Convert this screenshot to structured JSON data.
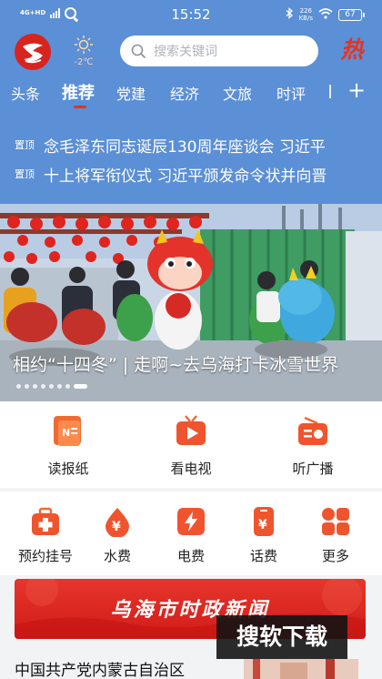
{
  "status_bar": {
    "network": "4G+HD",
    "time": "15:52",
    "net_speed_value": "226",
    "net_speed_unit": "KB/s",
    "battery": "67"
  },
  "header": {
    "weather_temp": "-2℃",
    "search_placeholder": "搜索关键词",
    "hot_label": "热",
    "accent_color": "#5b8fd6"
  },
  "tabs": [
    {
      "label": "头条"
    },
    {
      "label": "推荐"
    },
    {
      "label": "党建"
    },
    {
      "label": "经济"
    },
    {
      "label": "文旅"
    },
    {
      "label": "时评"
    }
  ],
  "active_tab": "推荐",
  "tab_add": "+",
  "pinned": [
    {
      "tag": "置顶",
      "text": "念毛泽东同志诞辰130周年座谈会 习近平"
    },
    {
      "tag": "置顶",
      "text": "十上将军衔仪式 习近平颁发命令状并向晋"
    }
  ],
  "banner": {
    "caption": "相约“十四冬” | 走啊~去乌海打卡冰雪世界",
    "slide_count": 8,
    "active_slide": 8
  },
  "services_row1": [
    {
      "label": "读报纸",
      "icon": "newspaper-icon"
    },
    {
      "label": "看电视",
      "icon": "tv-icon"
    },
    {
      "label": "听广播",
      "icon": "radio-icon"
    }
  ],
  "services_row2": [
    {
      "label": "预约挂号",
      "icon": "medical-kit-icon"
    },
    {
      "label": "水费",
      "icon": "water-drop-icon"
    },
    {
      "label": "电费",
      "icon": "lightning-icon"
    },
    {
      "label": "话费",
      "icon": "phone-bill-icon"
    },
    {
      "label": "更多",
      "icon": "grid-icon"
    }
  ],
  "news_banner_title": "乌海市时政新闻",
  "article_title": "中国共产党内蒙古自治区",
  "watermark": "搜软下载",
  "brand_red": "#e8331e"
}
